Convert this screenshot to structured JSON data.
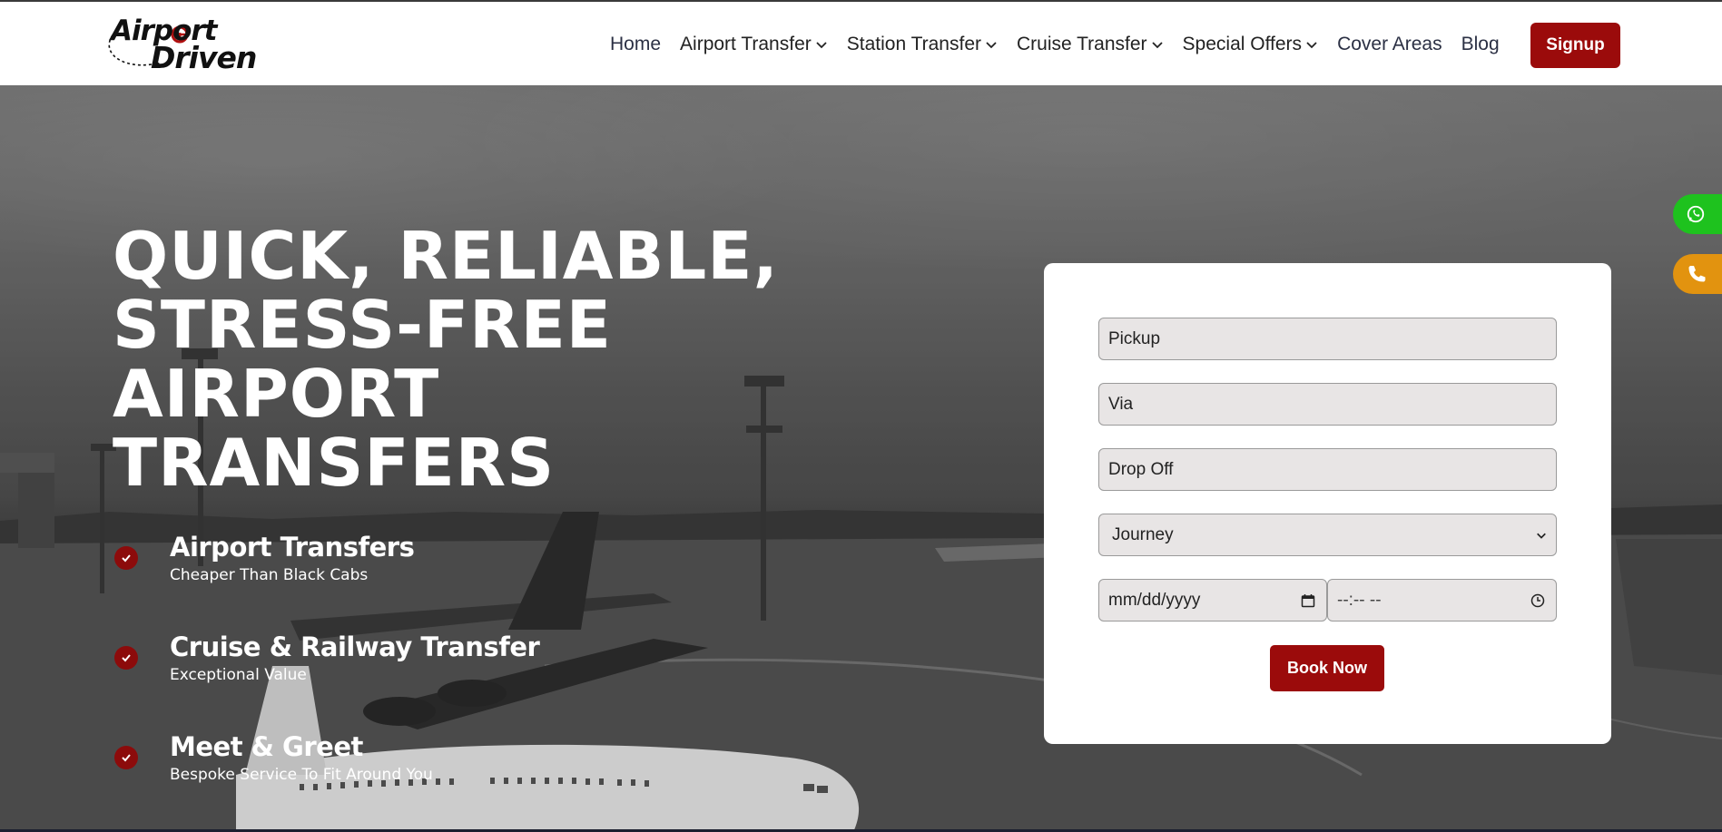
{
  "logo": {
    "line1": "Airport",
    "line2": "Driven"
  },
  "nav": {
    "items": [
      {
        "label": "Home",
        "dropdown": false
      },
      {
        "label": "Airport Transfer",
        "dropdown": true
      },
      {
        "label": "Station Transfer",
        "dropdown": true
      },
      {
        "label": "Cruise Transfer",
        "dropdown": true
      },
      {
        "label": "Special Offers",
        "dropdown": true
      },
      {
        "label": "Cover Areas",
        "dropdown": false
      },
      {
        "label": "Blog",
        "dropdown": false
      }
    ],
    "signup_label": "Signup"
  },
  "hero": {
    "headline": [
      "QUICK, RELIABLE,",
      "STRESS-FREE",
      "AIRPORT",
      "TRANSFERS"
    ],
    "features": [
      {
        "title": "Airport Transfers",
        "subtitle": "Cheaper Than Black Cabs"
      },
      {
        "title": "Cruise & Railway Transfer",
        "subtitle": "Exceptional Value"
      },
      {
        "title": "Meet & Greet",
        "subtitle": "Bespoke Service To Fit Around You"
      }
    ]
  },
  "booking_form": {
    "pickup_placeholder": "Pickup",
    "via_placeholder": "Via",
    "dropoff_placeholder": "Drop Off",
    "journey_selected": "Journey",
    "date_placeholder": "mm/dd/yyyy",
    "time_placeholder": "--:-- --",
    "book_label": "Book Now"
  },
  "side_buttons": {
    "whatsapp_icon": "whatsapp-icon",
    "phone_icon": "phone-icon"
  },
  "colors": {
    "brand_red": "#9b0b0b",
    "whatsapp_green": "#1ec21e",
    "phone_orange": "#e2930f"
  }
}
